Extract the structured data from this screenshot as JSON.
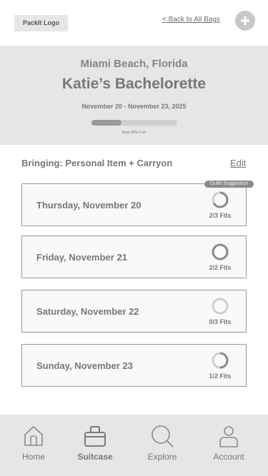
{
  "header": {
    "logo_text": "PackIt Logo",
    "back_link": "< Back to All Bags",
    "add_icon": "plus-icon"
  },
  "trip": {
    "location": "Miami Beach, Florida",
    "title": "Katie’s Bachelorette",
    "dates": "November 20 - November 23, 2025",
    "bag_fill_fraction": 0.35,
    "bag_fill_label": "Bag 30% Full"
  },
  "packing": {
    "bringing_label": "Bringing: Personal Item + Carryon",
    "edit_label": "Edit",
    "suggestion_badge": "Outfit Suggestion"
  },
  "days": [
    {
      "label": "Thursday, November 20",
      "fits": "2/3 Fits",
      "fraction": 0.67
    },
    {
      "label": "Friday, November 21",
      "fits": "2/2 Fits",
      "fraction": 1.0
    },
    {
      "label": "Saturday, November 22",
      "fits": "0/3 Fits",
      "fraction": 0.0
    },
    {
      "label": "Sunday, November 23",
      "fits": "1/2 Fits",
      "fraction": 0.5
    }
  ],
  "nav": {
    "items": [
      {
        "label": "Home",
        "icon": "home-icon",
        "active": false
      },
      {
        "label": "Suitcase",
        "icon": "suitcase-icon",
        "active": true
      },
      {
        "label": "Explore",
        "icon": "search-icon",
        "active": false
      },
      {
        "label": "Account",
        "icon": "user-icon",
        "active": false
      }
    ]
  },
  "colors": {
    "panel_bg": "#e6e6e6",
    "ring_track": "#cfcfcf",
    "ring_fill": "#8a8a8a",
    "badge_bg": "#8a8a8a"
  }
}
